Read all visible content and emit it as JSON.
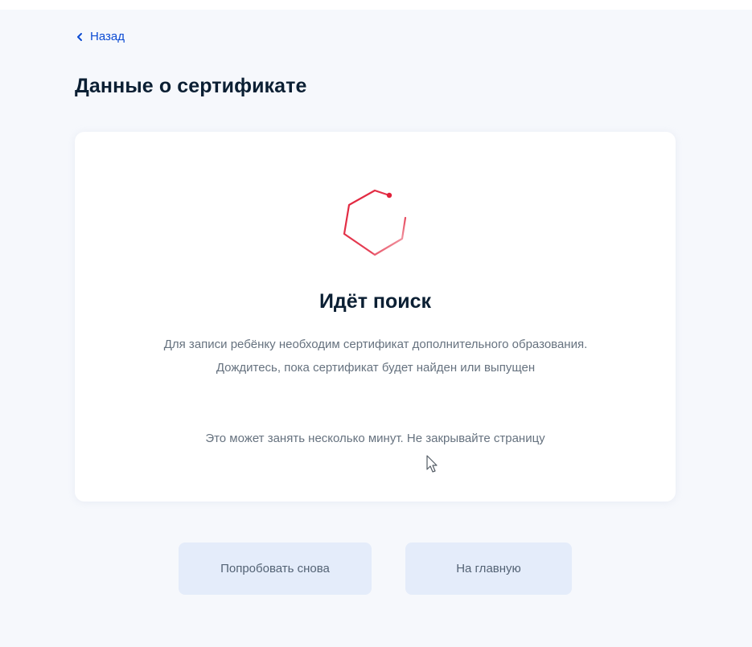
{
  "nav": {
    "back_label": "Назад"
  },
  "page": {
    "title": "Данные о сертификате"
  },
  "status": {
    "title": "Идёт поиск",
    "description": "Для записи ребёнку необходим сертификат дополнительного образования. Дождитесь, пока сертификат будет найден или выпущен",
    "note": "Это может занять несколько минут. Не закрывайте страницу"
  },
  "actions": {
    "retry_label": "Попробовать снова",
    "home_label": "На главную"
  },
  "icons": {
    "back": "chevron-left-icon",
    "spinner": "hexagon-spinner-icon",
    "cursor": "mouse-pointer-icon"
  },
  "colors": {
    "link": "#0d4cd3",
    "text_primary": "#0b1f33",
    "text_secondary": "#66727f",
    "spinner_accent": "#e1213a",
    "button_bg": "#e4ecfa",
    "page_bg": "#f6f8fc"
  }
}
